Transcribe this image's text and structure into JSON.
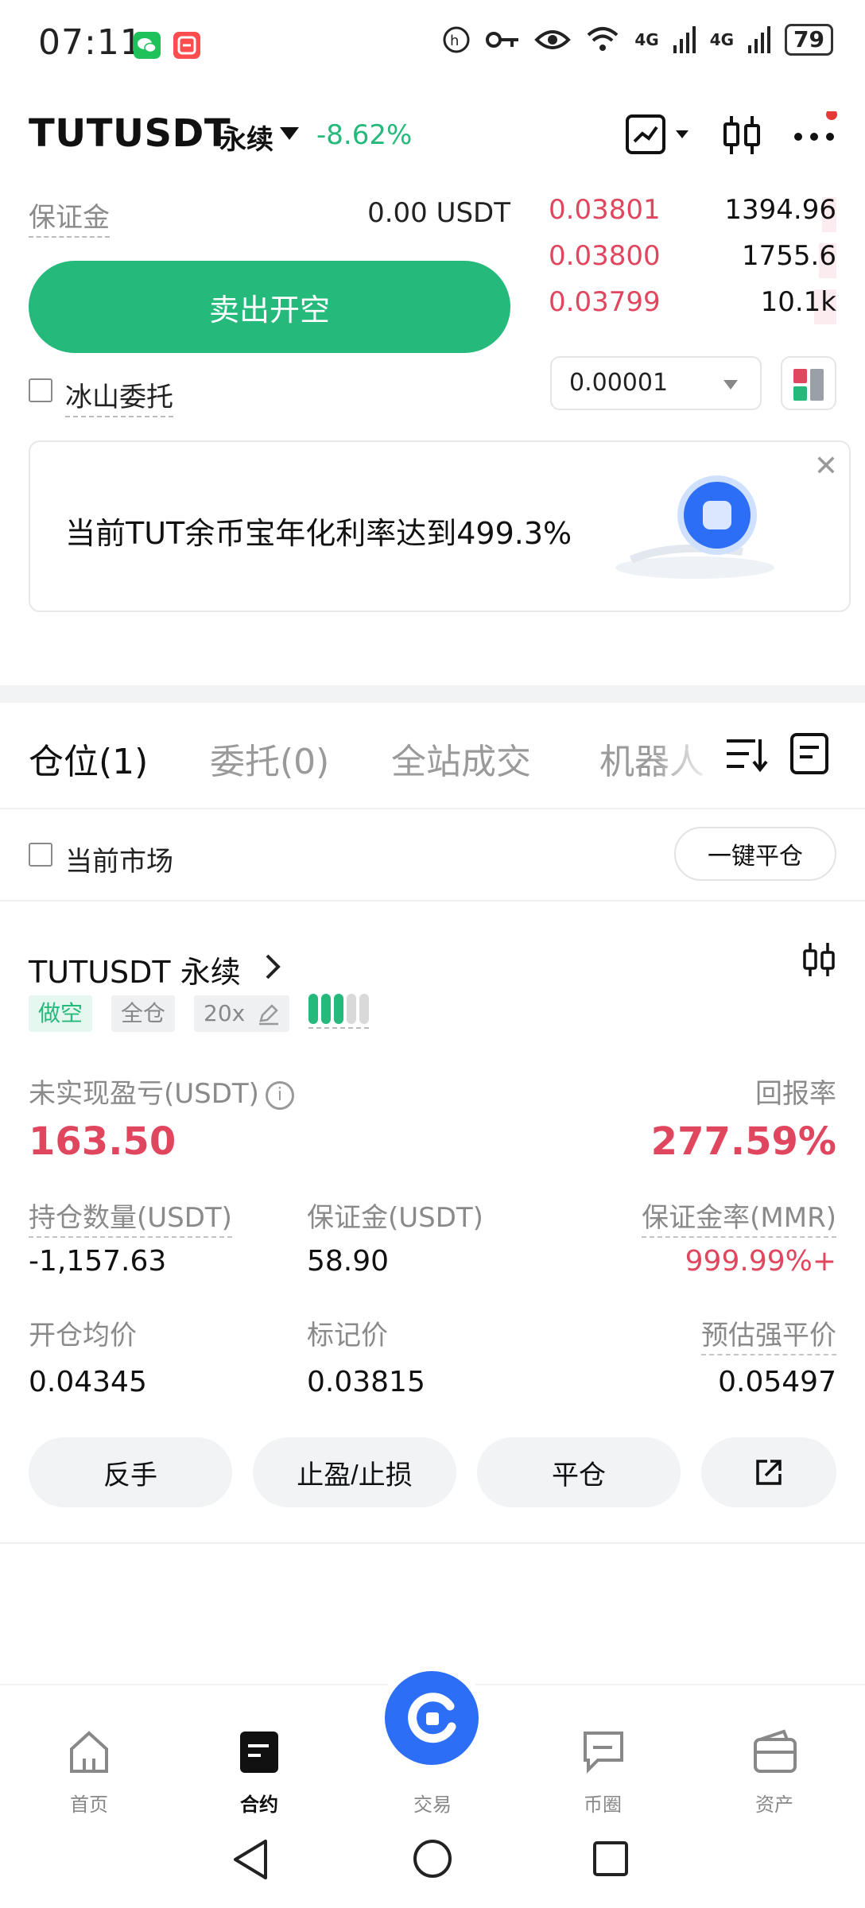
{
  "status_bar": {
    "time": "07:11",
    "network_1": "4G",
    "network_2": "4G",
    "battery": "79",
    "icons": [
      "wechat-icon",
      "taobao-icon",
      "hd-call-icon",
      "key-icon",
      "eye-icon",
      "wifi-icon",
      "signal-icon",
      "battery-icon"
    ]
  },
  "header": {
    "pair": "TUTUSDT",
    "contract_type": "永续",
    "change": "-8.62%",
    "icons": [
      "chart-icon",
      "candlestick-icon",
      "more-icon"
    ]
  },
  "trade_panel": {
    "margin_label": "保证金",
    "margin_value": "0.00 USDT",
    "sell_button": "卖出开空",
    "iceberg_label": "冰山委托"
  },
  "order_book": {
    "asks": [
      {
        "price": "0.03801",
        "qty": "1394.96",
        "depth": 0.05
      },
      {
        "price": "0.03800",
        "qty": "1755.6",
        "depth": 0.06
      },
      {
        "price": "0.03799",
        "qty": "10.1k",
        "depth": 0.08
      }
    ],
    "precision": "0.00001"
  },
  "banner": {
    "text": "当前TUT余币宝年化利率达到499.3%",
    "close": "✕"
  },
  "tabs": [
    {
      "label": "仓位(1)",
      "active": true
    },
    {
      "label": "委托(0)",
      "active": false
    },
    {
      "label": "全站成交",
      "active": false
    },
    {
      "label": "机器人",
      "active": false
    }
  ],
  "filter": {
    "current_market": "当前市场",
    "close_all": "一键平仓"
  },
  "position": {
    "title": "TUTUSDT 永续",
    "side_tag": "做空",
    "margin_mode_tag": "全仓",
    "leverage_tag": "20x",
    "risk_level": 0.6,
    "pnl_label": "未实现盈亏(USDT)",
    "pnl_value": "163.50",
    "roe_label": "回报率",
    "roe_value": "277.59%",
    "size_label": "持仓数量(USDT)",
    "size_value": "-1,157.63",
    "margin_label": "保证金(USDT)",
    "margin_value": "58.90",
    "mmr_label": "保证金率(MMR)",
    "mmr_value": "999.99%+",
    "entry_label": "开仓均价",
    "entry_value": "0.04345",
    "mark_label": "标记价",
    "mark_value": "0.03815",
    "liq_label": "预估强平价",
    "liq_value": "0.05497",
    "actions": {
      "reverse": "反手",
      "tpsl": "止盈/止损",
      "close": "平仓"
    }
  },
  "bottom_nav": {
    "home": "首页",
    "futures": "合约",
    "trade": "交易",
    "community": "币圈",
    "assets": "资产"
  },
  "colors": {
    "green": "#25b97c",
    "red": "#e0475f",
    "blue": "#2d6ef6"
  }
}
